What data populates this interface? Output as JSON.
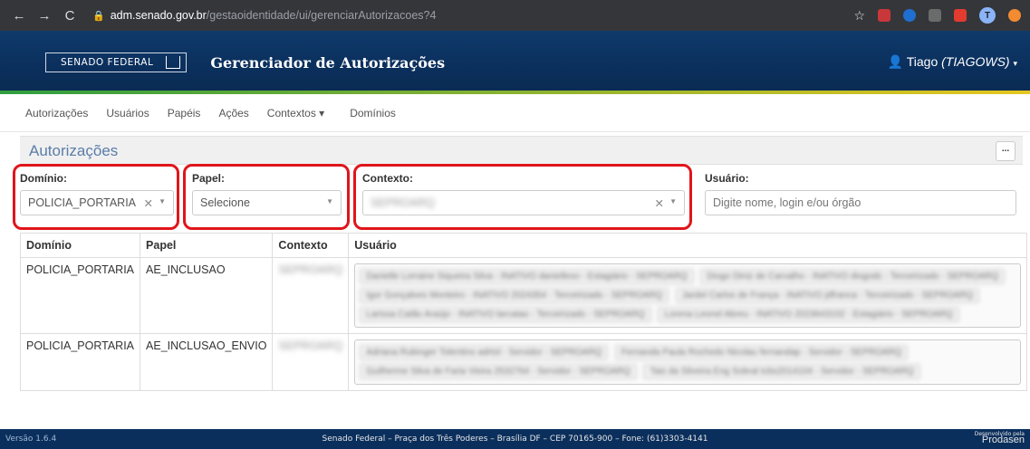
{
  "browser": {
    "url_host": "adm.senado.gov.br",
    "url_path": "/gestaoidentidade/ui/gerenciarAutorizacoes?4",
    "profile_initial": "T"
  },
  "header": {
    "logo_text": "SENADO FEDERAL",
    "title": "Gerenciador de Autorizações",
    "user_name": "Tiago",
    "user_login": "(TIAGOWS)"
  },
  "nav": {
    "items": [
      "Autorizações",
      "Usuários",
      "Papéis",
      "Ações",
      "Contextos ▾",
      "Domínios"
    ]
  },
  "panel": {
    "title": "Autorizações",
    "menu_label": "..."
  },
  "filters": {
    "dominio": {
      "label": "Domínio:",
      "value": "POLICIA_PORTARIA"
    },
    "papel": {
      "label": "Papel:",
      "value": "Selecione"
    },
    "contexto": {
      "label": "Contexto:",
      "value": "SEPROARQ"
    },
    "usuario": {
      "label": "Usuário:",
      "placeholder": "Digite nome, login e/ou órgão"
    }
  },
  "table": {
    "headers": [
      "Domínio",
      "Papel",
      "Contexto",
      "Usuário"
    ],
    "rows": [
      {
        "dominio": "POLICIA_PORTARIA",
        "papel": "AE_INCLUSAO",
        "contexto": "SEPROARQ",
        "usuarios": [
          "Danielle Lorraine Siqueira Silva - INATIVO danielleso - Estagiário - SEPROARQ",
          "Diogo Diniz de Carvalho - INATIVO diogodc - Terceirizado - SEPROARQ",
          "Igor Gonçalves Monteiro - INATIVO 2024354 - Terceirizado - SEPROARQ",
          "Jardel Carlos de França - INATIVO jdfranca - Terceirizado - SEPROARQ",
          "Larissa Catão Araújo - INATIVO larcatao - Terceirizado - SEPROARQ",
          "Lorena Leonel Abreu - INATIVO 2023643102 - Estagiário - SEPROARQ"
        ]
      },
      {
        "dominio": "POLICIA_PORTARIA",
        "papel": "AE_INCLUSAO_ENVIO",
        "contexto": "SEPROARQ",
        "usuarios": [
          "Adriana Rubinger Tolentino adrtol - Servidor - SEPROARQ",
          "Fernanda Paula Rochedo Nicolau fernandap - Servidor - SEPROARQ",
          "Guilherme Silva de Faria Vieira 2532764 - Servidor - SEPROARQ",
          "Tais da Silveira Eng Sobral tcbs2014104 - Servidor - SEPROARQ"
        ]
      }
    ]
  },
  "footer": {
    "version": "Versão 1.6.4",
    "address": "Senado Federal – Praça dos Três Poderes – Brasília DF – CEP 70165-900 – Fone: (61)3303-4141",
    "dev_by": "Desenvolvido pela",
    "dev_name": "Prodasen"
  },
  "colors": {
    "header_bg": "#0b2f5c",
    "accent_title": "#5a7da8",
    "highlight": "#e0151b"
  }
}
